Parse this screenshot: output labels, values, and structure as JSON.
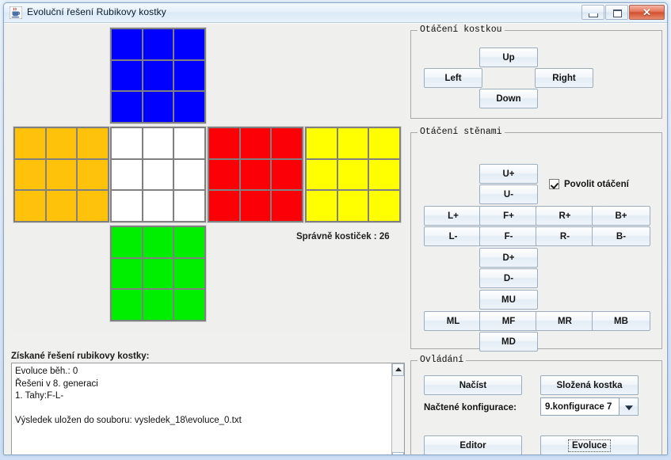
{
  "window": {
    "title": "Evoluční řešení Rubikovy kostky",
    "icon": "java-coffee-cup-icon",
    "buttons": {
      "minimize": "minimize-icon",
      "maximize": "maximize-icon",
      "close": "✕"
    }
  },
  "cube": {
    "score_label": "Správně kostiček : 26",
    "colors": {
      "blue": "#0000ff",
      "orange": "#ffc20a",
      "white": "#ffffff",
      "red": "#fb0007",
      "yellow": "#ffff00",
      "green": "#00ef00",
      "grid": "#808080"
    },
    "faces": [
      {
        "name": "up",
        "color": "blue",
        "stickers": [
          "blue",
          "blue",
          "blue",
          "blue",
          "blue",
          "blue",
          "blue",
          "blue",
          "blue"
        ]
      },
      {
        "name": "left",
        "color": "orange",
        "stickers": [
          "orange",
          "orange",
          "orange",
          "orange",
          "orange",
          "orange",
          "orange",
          "orange",
          "orange"
        ]
      },
      {
        "name": "front",
        "color": "white",
        "stickers": [
          "white",
          "white",
          "white",
          "white",
          "white",
          "white",
          "white",
          "white",
          "white"
        ]
      },
      {
        "name": "right",
        "color": "red",
        "stickers": [
          "red",
          "red",
          "red",
          "red",
          "red",
          "red",
          "red",
          "red",
          "red"
        ]
      },
      {
        "name": "back",
        "color": "yellow",
        "stickers": [
          "yellow",
          "yellow",
          "yellow",
          "yellow",
          "yellow",
          "yellow",
          "yellow",
          "yellow",
          "yellow"
        ]
      },
      {
        "name": "down",
        "color": "green",
        "stickers": [
          "green",
          "green",
          "green",
          "green",
          "green",
          "green",
          "green",
          "green",
          "green"
        ]
      }
    ]
  },
  "output": {
    "label": "Získané řešení rubikovy kostky:",
    "text": "Evoluce běh.: 0\nŘešeni v 8. generaci\n1. Tahy:F-L-\n\nVýsledek uložen do souboru: vysledek_18\\evoluce_0.txt",
    "scroll_up": "scroll-up-arrow",
    "scroll_down": "scroll-down-arrow"
  },
  "cube_rotation": {
    "title": "Otáčení kostkou",
    "up": "Up",
    "left": "Left",
    "right": "Right",
    "down": "Down"
  },
  "face_rotation": {
    "title": "Otáčení stěnami",
    "enable_label": "Povolit otáčení",
    "enable_checked": true,
    "buttons": {
      "u_plus": "U+",
      "u_minus": "U-",
      "l_plus": "L+",
      "f_plus": "F+",
      "r_plus": "R+",
      "b_plus": "B+",
      "l_minus": "L-",
      "f_minus": "F-",
      "r_minus": "R-",
      "b_minus": "B-",
      "d_plus": "D+",
      "d_minus": "D-",
      "mu": "MU",
      "ml": "ML",
      "mf": "MF",
      "mr": "MR",
      "mb": "MB",
      "md": "MD"
    }
  },
  "control": {
    "title": "Ovládání",
    "load": "Načíst",
    "solved_cube": "Složená kostka",
    "config_label": "Načtené konfigurace:",
    "config_value": "9.konfigurace 7",
    "editor": "Editor",
    "evolution": "Evoluce"
  }
}
